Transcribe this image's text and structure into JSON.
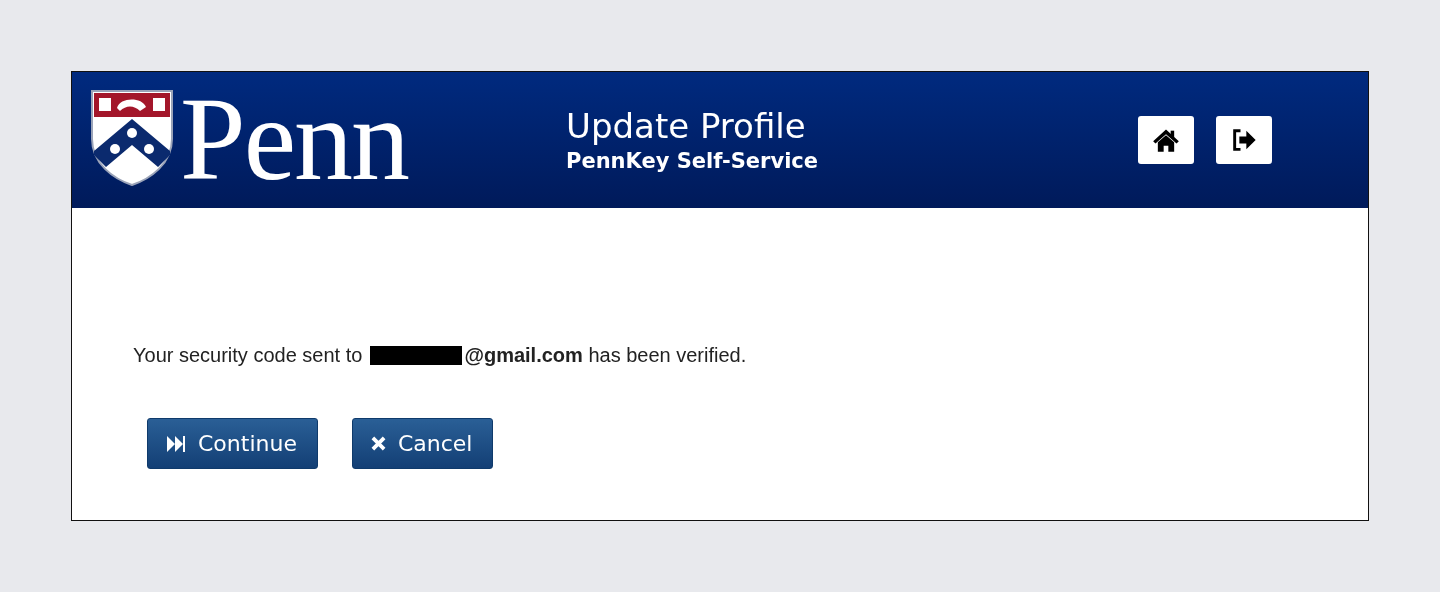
{
  "header": {
    "logo_text": "Penn",
    "title": "Update Profile",
    "subtitle": "PennKey Self-Service",
    "icons": [
      {
        "kind": "home"
      },
      {
        "kind": "logout"
      }
    ]
  },
  "message": {
    "before": "Your security code sent to",
    "redacted": true,
    "after": "**@gmail.com** has been verified."
  },
  "buttons": [
    {
      "kind": "continue",
      "label": "Continue"
    },
    {
      "kind": "cancel",
      "label": "Cancel"
    }
  ]
}
